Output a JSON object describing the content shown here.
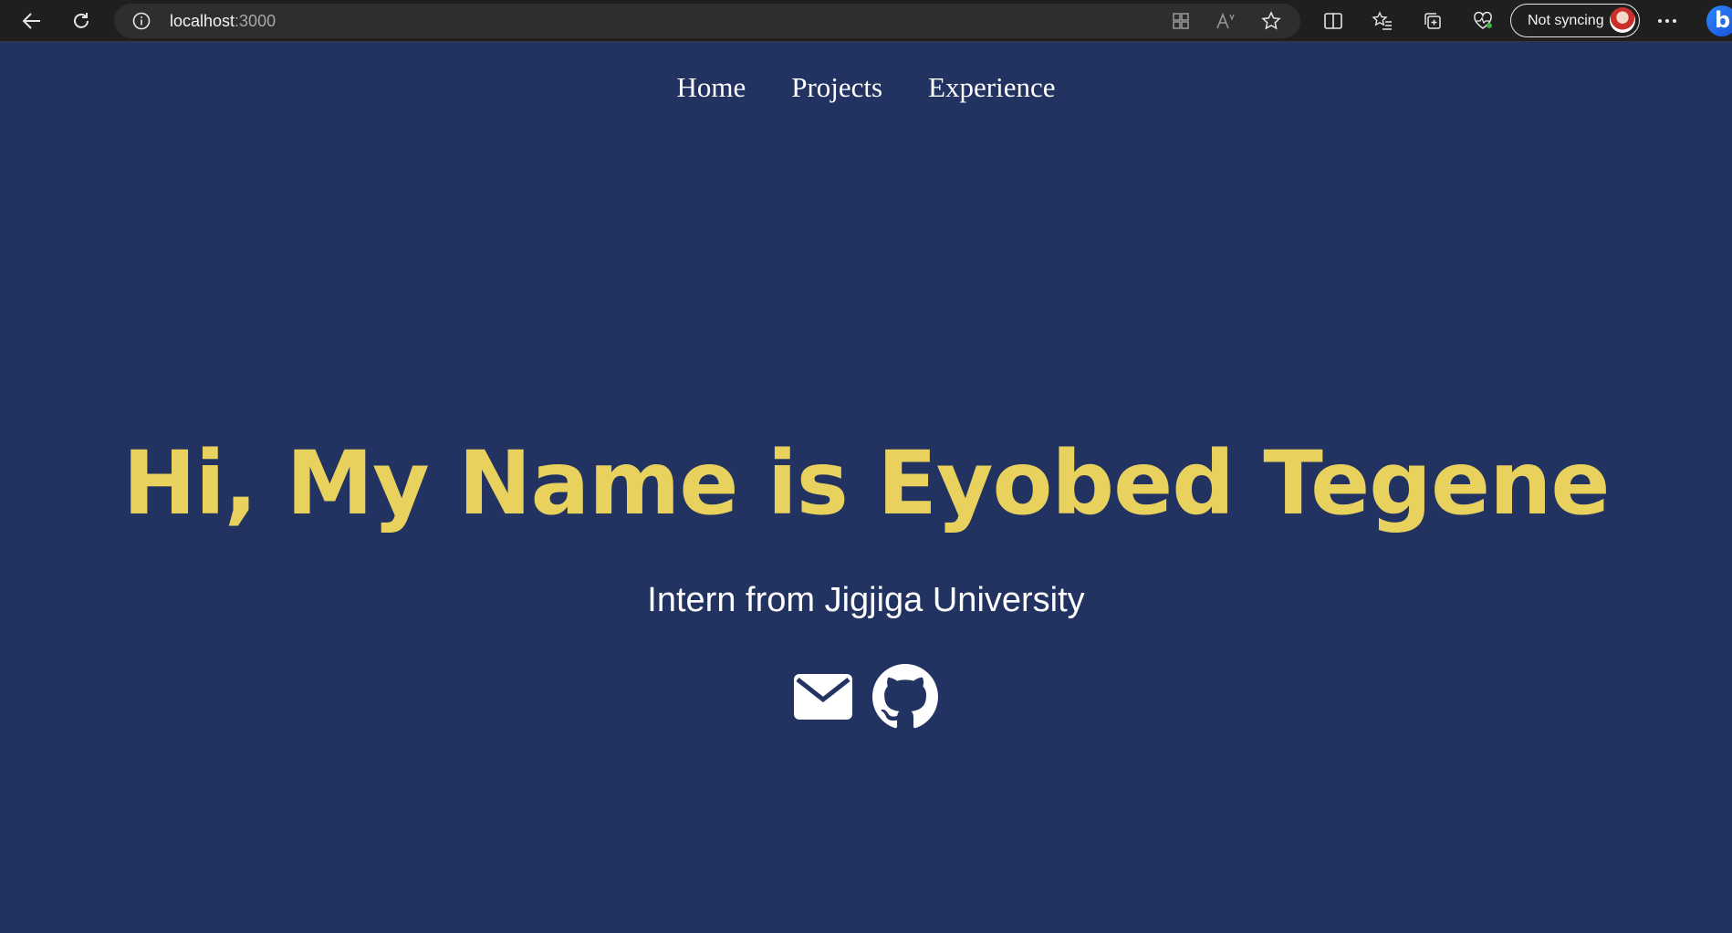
{
  "browser": {
    "url_host": "localhost",
    "url_port": ":3000",
    "sync_label": "Not syncing"
  },
  "nav": {
    "items": [
      {
        "label": "Home"
      },
      {
        "label": "Projects"
      },
      {
        "label": "Experience"
      }
    ]
  },
  "hero": {
    "title": "Hi, My Name is Eyobed Tegene",
    "subtitle": "Intern from Jigjiga University"
  },
  "socials": [
    {
      "icon": "mail-icon"
    },
    {
      "icon": "github-icon"
    }
  ],
  "colors": {
    "background": "#223361",
    "accent": "#e9d15e",
    "text": "#ffffff"
  }
}
